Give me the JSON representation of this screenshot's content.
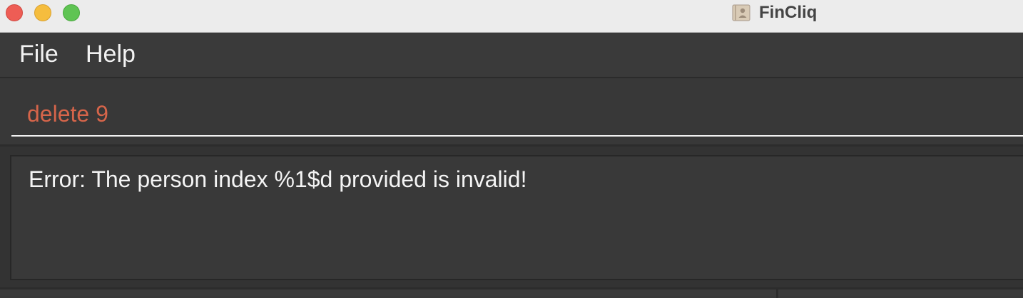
{
  "window": {
    "title": "FinCliq",
    "app_icon": "contacts-book-icon",
    "controls": [
      "close",
      "minimize",
      "zoom"
    ]
  },
  "menubar": {
    "items": [
      {
        "label": "File"
      },
      {
        "label": "Help"
      }
    ]
  },
  "command_box": {
    "value": "delete 9",
    "text_color": "#d6654a"
  },
  "result_display": {
    "message": "Error: The person index %1$d provided is invalid!"
  },
  "colors": {
    "background": "#383838",
    "titlebar": "#ececec",
    "close": "#ee5d55",
    "minimize": "#f5bd3e",
    "zoom": "#5fc453"
  }
}
